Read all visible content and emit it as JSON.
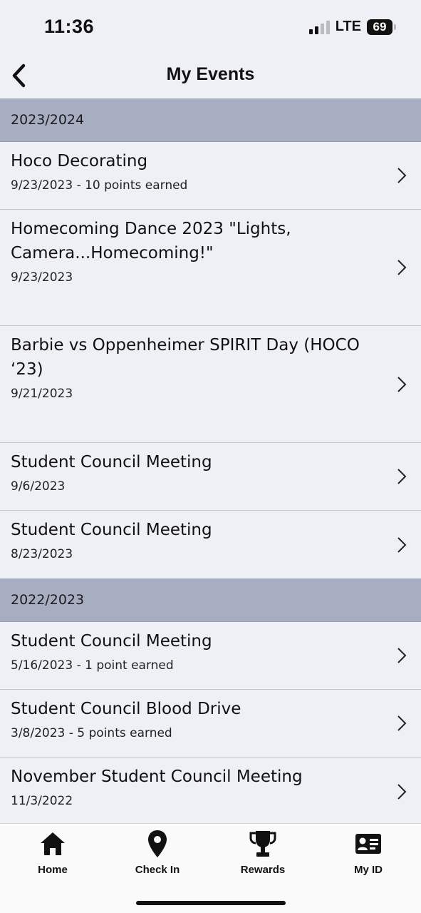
{
  "status_bar": {
    "time": "11:36",
    "network": "LTE",
    "battery": "69"
  },
  "nav": {
    "title": "My Events"
  },
  "sections": [
    {
      "header": "2023/2024",
      "events": [
        {
          "title": "Hoco Decorating",
          "subtitle": "9/23/2023 - 10 points earned"
        },
        {
          "title": "Homecoming Dance 2023 \"Lights, Camera...Homecoming!\"",
          "subtitle": "9/23/2023"
        },
        {
          "title": "Barbie vs Oppenheimer SPIRIT Day (HOCO ‘23)",
          "subtitle": "9/21/2023"
        },
        {
          "title": "Student Council Meeting",
          "subtitle": "9/6/2023"
        },
        {
          "title": "Student Council Meeting",
          "subtitle": "8/23/2023"
        }
      ]
    },
    {
      "header": "2022/2023",
      "events": [
        {
          "title": "Student Council Meeting",
          "subtitle": "5/16/2023 - 1 point earned"
        },
        {
          "title": "Student Council Blood Drive",
          "subtitle": "3/8/2023 - 5 points earned"
        },
        {
          "title": "November Student Council Meeting",
          "subtitle": "11/3/2022"
        }
      ]
    }
  ],
  "tabs": [
    {
      "label": "Home",
      "icon": "home-icon"
    },
    {
      "label": "Check In",
      "icon": "location-pin-icon"
    },
    {
      "label": "Rewards",
      "icon": "trophy-icon"
    },
    {
      "label": "My ID",
      "icon": "id-card-icon"
    }
  ]
}
